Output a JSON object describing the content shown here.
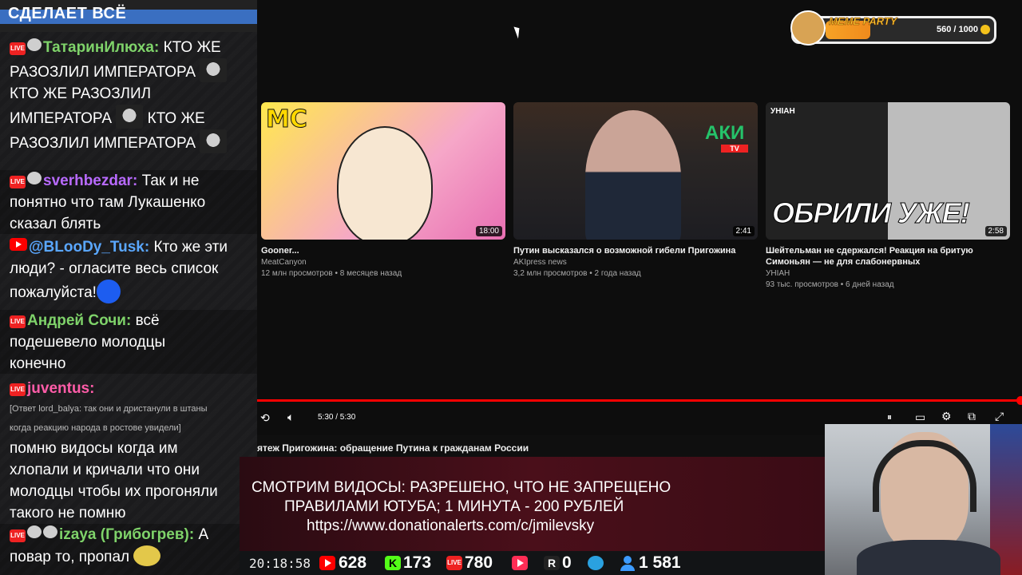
{
  "chat": {
    "header": "СДЕЛАЕТ ВСЁ",
    "messages": [
      {
        "user": "ТатаринИлюха:",
        "lines": [
          "КТО ЖЕ",
          "РАЗОЗЛИЛ ИМПЕРАТОРА",
          "КТО ЖЕ РАЗОЗЛИЛ",
          "ИМПЕРАТОРА",
          "КТО ЖЕ",
          "РАЗОЗЛИЛ ИМПЕРАТОРА"
        ]
      },
      {
        "user": "sverhbezdar:",
        "lines": [
          "Так и не",
          "понятно что там Лукашенко",
          "сказал блять"
        ]
      },
      {
        "user": "@BLooDy_Tusk:",
        "lines": [
          "Кто же эти",
          "люди? - огласите весь список",
          "пожалуйста!"
        ]
      },
      {
        "user": "Андрей Сочи:",
        "lines": [
          "всё",
          "подешевело молодцы",
          "конечно"
        ]
      },
      {
        "user": "juventus:",
        "reply": [
          "[Ответ lord_balya: так они и дристанули в штаны",
          "когда реакцию народа в ростове увидели]"
        ],
        "lines": [
          "помню видосы когда им",
          "хлопали и кричали что они",
          "молодцы чтобы их прогоняли",
          "такого не помню"
        ]
      },
      {
        "user": "izaya (Грибогрев):",
        "lines": [
          "А",
          "повар то, пропал"
        ]
      }
    ]
  },
  "videos": [
    {
      "title": "Gooner...",
      "channel": "MeatCanyon",
      "meta": "12 млн просмотров • 8 месяцев назад",
      "duration": "18:00",
      "thumb_text": "MC"
    },
    {
      "title": "Путин высказался о возможной гибели Пригожина",
      "channel": "AKIpress news",
      "meta": "3,2 млн просмотров • 2 года назад",
      "duration": "2:41",
      "thumb_text": "АКИ",
      "thumb_sub": "TV"
    },
    {
      "title": "Шейтельман не сдержался! Реакция на бритую Симоньян — не для слабонервных",
      "channel": "УНІАН",
      "meta": "93 тыс. просмотров • 6 дней назад",
      "duration": "2:58",
      "thumb_text": "ОБРИЛИ УЖЕ!",
      "thumb_ch": "УНІАН"
    }
  ],
  "player": {
    "time": "5:30 / 5:30",
    "progress": 1.0,
    "video_title": "ятеж Пригожина: обращение Путина к гражданам России"
  },
  "meme_party": {
    "label": "MEME PARTY",
    "count": "560 / 1000",
    "progress": 0.56
  },
  "banner": {
    "line1": "СМОТРИМ ВИДОСЫ: РАЗРЕШЕНО, ЧТО НЕ ЗАПРЕЩЕНО",
    "line2": "ПРАВИЛАМИ ЮТУБА; 1 МИНУТА - 200 РУБЛЕЙ",
    "line3": "https://www.donationalerts.com/c/jmilevsky"
  },
  "stats": {
    "clock": "20:18:58",
    "youtube": "628",
    "kick": "173",
    "live": "780",
    "rutube": "0",
    "total": "1 581",
    "kick_letter": "K",
    "rutube_letter": "R",
    "live_label": "LIVE"
  },
  "colors": {
    "accent": "#ff0000",
    "chat_bg": "#1b1b1d",
    "banner_bg": "#4a0f1a"
  }
}
